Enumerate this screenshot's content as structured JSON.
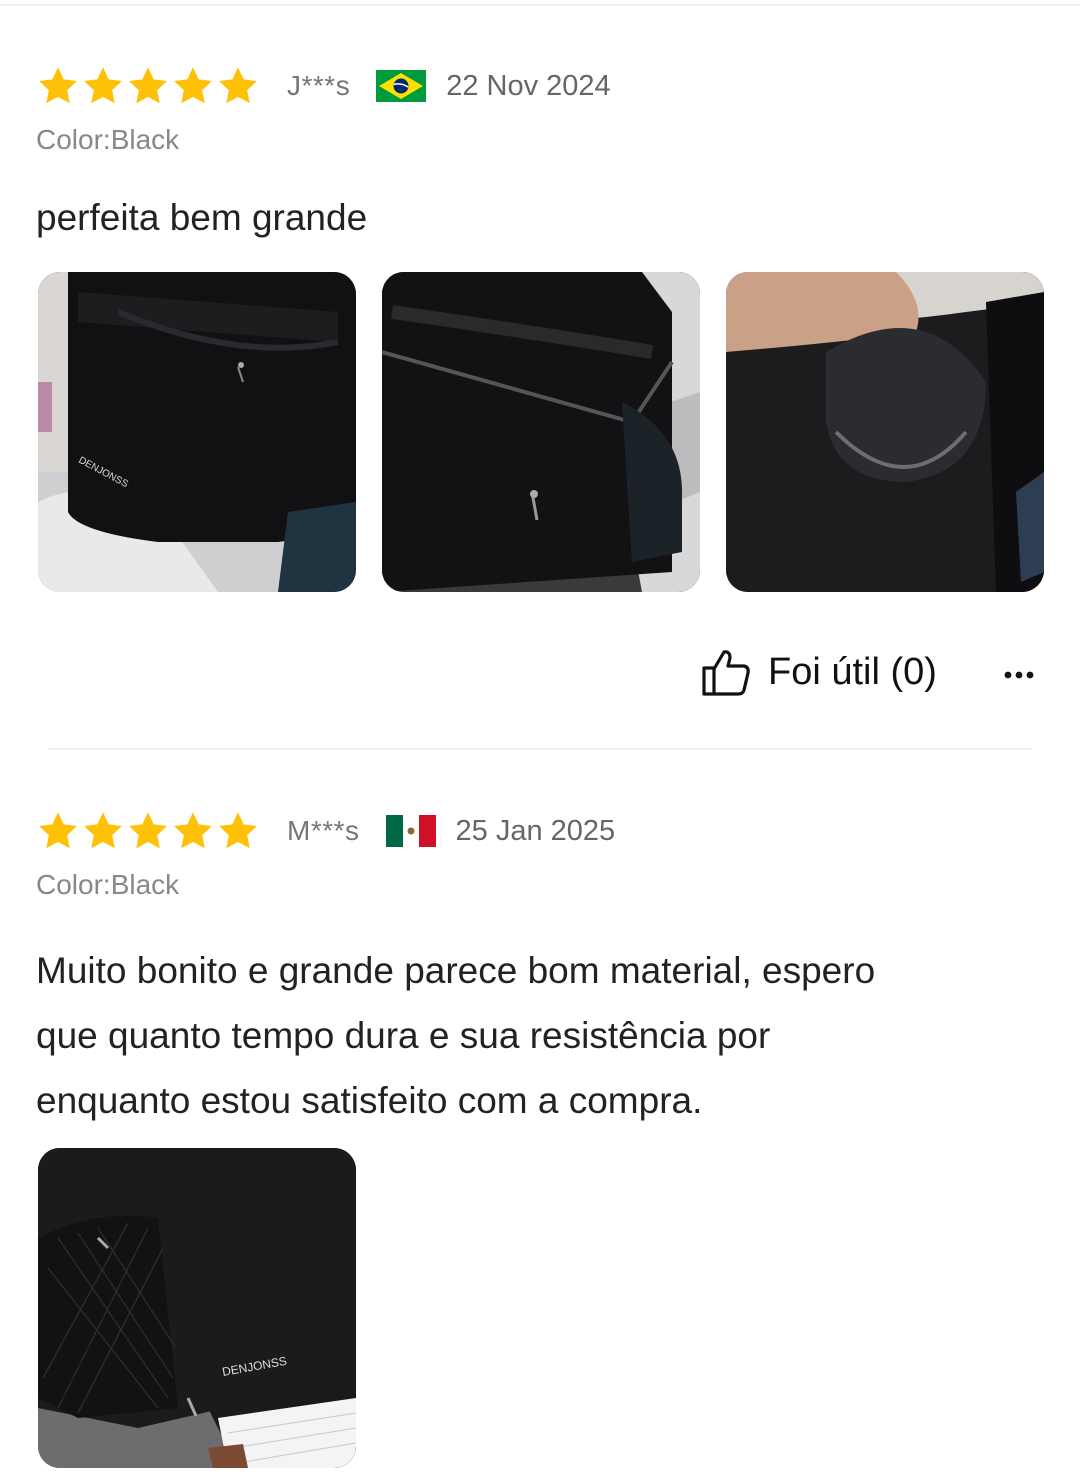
{
  "reviews": [
    {
      "rating": 5,
      "reviewer": "J***s",
      "country_flag": "brazil-flag-icon",
      "date": "22 Nov 2024",
      "sku": "Color:Black",
      "text": "perfeita bem grande",
      "photos": [
        "black-bag-front-photo",
        "black-bag-open-top-photo",
        "black-bag-inner-pocket-photo"
      ],
      "helpful_label": "Foi útil (0)"
    },
    {
      "rating": 5,
      "reviewer": "M***s",
      "country_flag": "mexico-flag-icon",
      "date": "25 Jan 2025",
      "sku": "Color:Black",
      "text_lines": [
        "Muito bonito e grande parece bom material, espero",
        "que quanto tempo dura e sua resistência por",
        "enquanto estou satisfeito com a compra."
      ],
      "photos": [
        "black-bag-side-mesh-pocket-photo"
      ]
    }
  ],
  "colors": {
    "star": "#FFC107",
    "muted_text": "#888888",
    "divider": "#EEEEEE"
  }
}
